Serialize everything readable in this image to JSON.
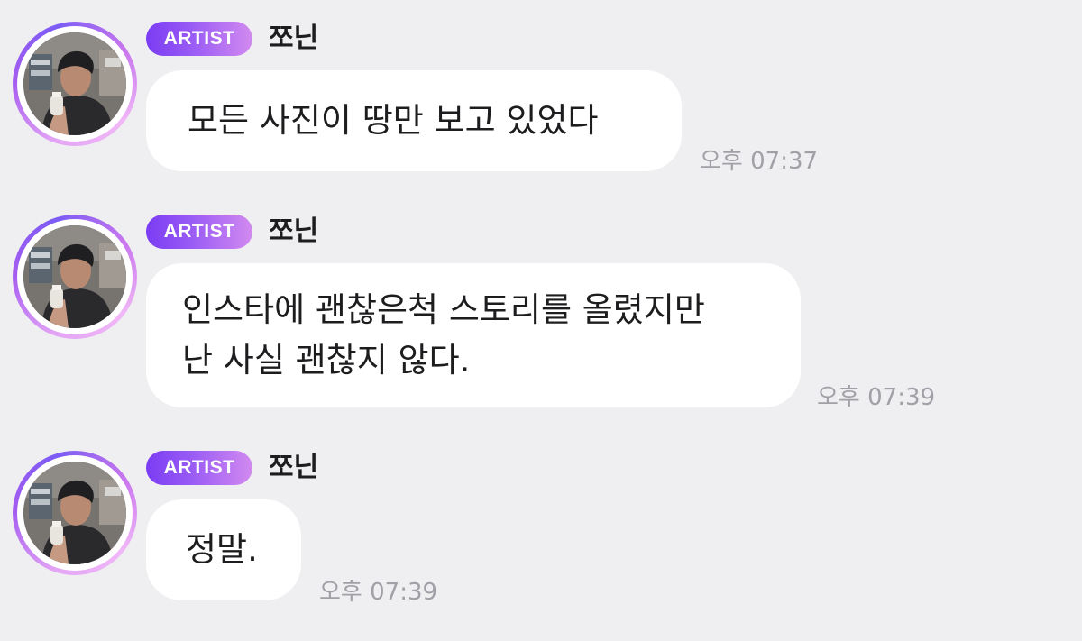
{
  "colors": {
    "background": "#efeff1",
    "bubble": "#ffffff",
    "badge_gradient_start": "#7a3cf3",
    "badge_gradient_end": "#d28af0",
    "timestamp": "#a0a0a6",
    "text": "#1d1d1f"
  },
  "messages": [
    {
      "badge": "ARTIST",
      "sender": "쪼닌",
      "text": "모든 사진이 땅만 보고 있었다",
      "time": "오후 07:37"
    },
    {
      "badge": "ARTIST",
      "sender": "쪼닌",
      "text": "인스타에 괜찮은척 스토리를 올렸지만\n난 사실 괜찮지 않다.",
      "time": "오후 07:39"
    },
    {
      "badge": "ARTIST",
      "sender": "쪼닌",
      "text": "정말.",
      "time": "오후 07:39"
    }
  ]
}
